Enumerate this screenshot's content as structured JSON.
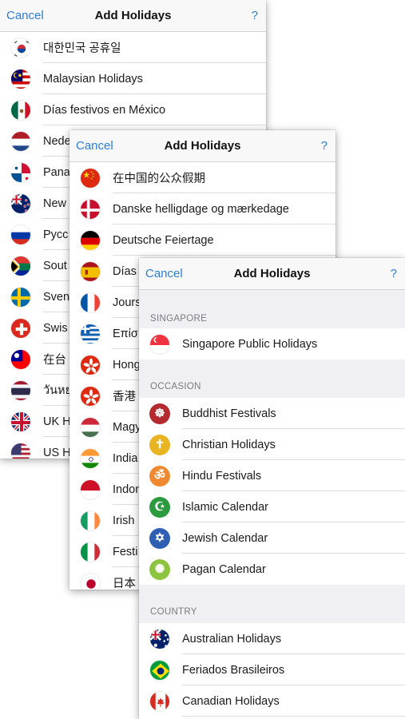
{
  "panels": [
    {
      "cancel": "Cancel",
      "title": "Add Holidays",
      "help": "?",
      "items": [
        {
          "label": "대한민국 공휴일",
          "icon": "south-korea-flag-icon"
        },
        {
          "label": "Malaysian Holidays",
          "icon": "malaysia-flag-icon"
        },
        {
          "label": "Días festivos en México",
          "icon": "mexico-flag-icon"
        },
        {
          "label": "Nede",
          "icon": "netherlands-flag-icon"
        },
        {
          "label": "Pana",
          "icon": "panama-flag-icon"
        },
        {
          "label": "New",
          "icon": "new-zealand-flag-icon"
        },
        {
          "label": "Pycc",
          "icon": "russia-flag-icon"
        },
        {
          "label": "Sout",
          "icon": "south-africa-flag-icon"
        },
        {
          "label": "Sven",
          "icon": "sweden-flag-icon"
        },
        {
          "label": "Swis",
          "icon": "switzerland-flag-icon"
        },
        {
          "label": "在台",
          "icon": "taiwan-flag-icon"
        },
        {
          "label": "วันหยุ",
          "icon": "thailand-flag-icon"
        },
        {
          "label": "UK H",
          "icon": "uk-flag-icon"
        },
        {
          "label": "US H",
          "icon": "us-flag-icon"
        }
      ]
    },
    {
      "cancel": "Cancel",
      "title": "Add Holidays",
      "help": "?",
      "items": [
        {
          "label": "在中国的公众假期",
          "icon": "china-flag-icon"
        },
        {
          "label": "Danske helligdage og mærkedage",
          "icon": "denmark-flag-icon"
        },
        {
          "label": "Deutsche Feiertage",
          "icon": "germany-flag-icon"
        },
        {
          "label": "Días",
          "icon": "spain-flag-icon"
        },
        {
          "label": "Jours",
          "icon": "france-flag-icon"
        },
        {
          "label": "Επίσ",
          "icon": "greece-flag-icon"
        },
        {
          "label": "Hong",
          "icon": "hong-kong-flag-icon"
        },
        {
          "label": "香港",
          "icon": "hong-kong-flag-icon"
        },
        {
          "label": "Magy",
          "icon": "hungary-flag-icon"
        },
        {
          "label": "India",
          "icon": "india-flag-icon"
        },
        {
          "label": "Indon",
          "icon": "indonesia-flag-icon"
        },
        {
          "label": "Irish",
          "icon": "ireland-flag-icon"
        },
        {
          "label": "Festi",
          "icon": "italy-flag-icon"
        },
        {
          "label": "日本",
          "icon": "japan-flag-icon"
        }
      ]
    },
    {
      "cancel": "Cancel",
      "title": "Add Holidays",
      "help": "?",
      "sections": [
        {
          "header": "SINGAPORE",
          "items": [
            {
              "label": "Singapore Public Holidays",
              "icon": "singapore-flag-icon"
            }
          ]
        },
        {
          "header": "OCCASION",
          "items": [
            {
              "label": "Buddhist Festivals",
              "icon": "dharma-wheel-icon",
              "color": "#b52a2f",
              "glyph": "☸"
            },
            {
              "label": "Christian Holidays",
              "icon": "cross-icon",
              "color": "#e8b422",
              "glyph": "✝"
            },
            {
              "label": "Hindu Festivals",
              "icon": "om-icon",
              "color": "#ef8a33",
              "glyph": "ॐ"
            },
            {
              "label": "Islamic Calendar",
              "icon": "crescent-icon",
              "color": "#2c9a3f",
              "glyph": "☪"
            },
            {
              "label": "Jewish Calendar",
              "icon": "star-of-david-icon",
              "color": "#2f5fb3",
              "glyph": "✡"
            },
            {
              "label": "Pagan Calendar",
              "icon": "pagan-wheel-icon",
              "color": "#8dc43f",
              "glyph": "✺"
            }
          ]
        },
        {
          "header": "COUNTRY",
          "items": [
            {
              "label": "Australian Holidays",
              "icon": "australia-flag-icon"
            },
            {
              "label": "Feriados Brasileiros",
              "icon": "brazil-flag-icon"
            },
            {
              "label": "Canadian Holidays",
              "icon": "canada-flag-icon"
            },
            {
              "label": "",
              "icon": "partial-flag-icon"
            }
          ]
        }
      ]
    }
  ]
}
